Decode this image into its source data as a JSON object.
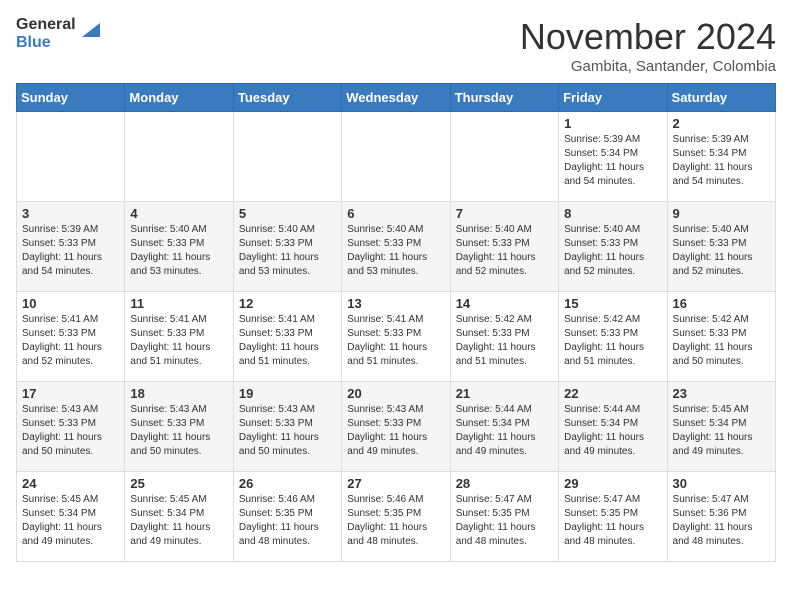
{
  "header": {
    "logo_general": "General",
    "logo_blue": "Blue",
    "month_year": "November 2024",
    "location": "Gambita, Santander, Colombia"
  },
  "weekdays": [
    "Sunday",
    "Monday",
    "Tuesday",
    "Wednesday",
    "Thursday",
    "Friday",
    "Saturday"
  ],
  "weeks": [
    [
      {
        "day": "",
        "sunrise": "",
        "sunset": "",
        "daylight": ""
      },
      {
        "day": "",
        "sunrise": "",
        "sunset": "",
        "daylight": ""
      },
      {
        "day": "",
        "sunrise": "",
        "sunset": "",
        "daylight": ""
      },
      {
        "day": "",
        "sunrise": "",
        "sunset": "",
        "daylight": ""
      },
      {
        "day": "",
        "sunrise": "",
        "sunset": "",
        "daylight": ""
      },
      {
        "day": "1",
        "sunrise": "Sunrise: 5:39 AM",
        "sunset": "Sunset: 5:34 PM",
        "daylight": "Daylight: 11 hours and 54 minutes."
      },
      {
        "day": "2",
        "sunrise": "Sunrise: 5:39 AM",
        "sunset": "Sunset: 5:34 PM",
        "daylight": "Daylight: 11 hours and 54 minutes."
      }
    ],
    [
      {
        "day": "3",
        "sunrise": "Sunrise: 5:39 AM",
        "sunset": "Sunset: 5:33 PM",
        "daylight": "Daylight: 11 hours and 54 minutes."
      },
      {
        "day": "4",
        "sunrise": "Sunrise: 5:40 AM",
        "sunset": "Sunset: 5:33 PM",
        "daylight": "Daylight: 11 hours and 53 minutes."
      },
      {
        "day": "5",
        "sunrise": "Sunrise: 5:40 AM",
        "sunset": "Sunset: 5:33 PM",
        "daylight": "Daylight: 11 hours and 53 minutes."
      },
      {
        "day": "6",
        "sunrise": "Sunrise: 5:40 AM",
        "sunset": "Sunset: 5:33 PM",
        "daylight": "Daylight: 11 hours and 53 minutes."
      },
      {
        "day": "7",
        "sunrise": "Sunrise: 5:40 AM",
        "sunset": "Sunset: 5:33 PM",
        "daylight": "Daylight: 11 hours and 52 minutes."
      },
      {
        "day": "8",
        "sunrise": "Sunrise: 5:40 AM",
        "sunset": "Sunset: 5:33 PM",
        "daylight": "Daylight: 11 hours and 52 minutes."
      },
      {
        "day": "9",
        "sunrise": "Sunrise: 5:40 AM",
        "sunset": "Sunset: 5:33 PM",
        "daylight": "Daylight: 11 hours and 52 minutes."
      }
    ],
    [
      {
        "day": "10",
        "sunrise": "Sunrise: 5:41 AM",
        "sunset": "Sunset: 5:33 PM",
        "daylight": "Daylight: 11 hours and 52 minutes."
      },
      {
        "day": "11",
        "sunrise": "Sunrise: 5:41 AM",
        "sunset": "Sunset: 5:33 PM",
        "daylight": "Daylight: 11 hours and 51 minutes."
      },
      {
        "day": "12",
        "sunrise": "Sunrise: 5:41 AM",
        "sunset": "Sunset: 5:33 PM",
        "daylight": "Daylight: 11 hours and 51 minutes."
      },
      {
        "day": "13",
        "sunrise": "Sunrise: 5:41 AM",
        "sunset": "Sunset: 5:33 PM",
        "daylight": "Daylight: 11 hours and 51 minutes."
      },
      {
        "day": "14",
        "sunrise": "Sunrise: 5:42 AM",
        "sunset": "Sunset: 5:33 PM",
        "daylight": "Daylight: 11 hours and 51 minutes."
      },
      {
        "day": "15",
        "sunrise": "Sunrise: 5:42 AM",
        "sunset": "Sunset: 5:33 PM",
        "daylight": "Daylight: 11 hours and 51 minutes."
      },
      {
        "day": "16",
        "sunrise": "Sunrise: 5:42 AM",
        "sunset": "Sunset: 5:33 PM",
        "daylight": "Daylight: 11 hours and 50 minutes."
      }
    ],
    [
      {
        "day": "17",
        "sunrise": "Sunrise: 5:43 AM",
        "sunset": "Sunset: 5:33 PM",
        "daylight": "Daylight: 11 hours and 50 minutes."
      },
      {
        "day": "18",
        "sunrise": "Sunrise: 5:43 AM",
        "sunset": "Sunset: 5:33 PM",
        "daylight": "Daylight: 11 hours and 50 minutes."
      },
      {
        "day": "19",
        "sunrise": "Sunrise: 5:43 AM",
        "sunset": "Sunset: 5:33 PM",
        "daylight": "Daylight: 11 hours and 50 minutes."
      },
      {
        "day": "20",
        "sunrise": "Sunrise: 5:43 AM",
        "sunset": "Sunset: 5:33 PM",
        "daylight": "Daylight: 11 hours and 49 minutes."
      },
      {
        "day": "21",
        "sunrise": "Sunrise: 5:44 AM",
        "sunset": "Sunset: 5:34 PM",
        "daylight": "Daylight: 11 hours and 49 minutes."
      },
      {
        "day": "22",
        "sunrise": "Sunrise: 5:44 AM",
        "sunset": "Sunset: 5:34 PM",
        "daylight": "Daylight: 11 hours and 49 minutes."
      },
      {
        "day": "23",
        "sunrise": "Sunrise: 5:45 AM",
        "sunset": "Sunset: 5:34 PM",
        "daylight": "Daylight: 11 hours and 49 minutes."
      }
    ],
    [
      {
        "day": "24",
        "sunrise": "Sunrise: 5:45 AM",
        "sunset": "Sunset: 5:34 PM",
        "daylight": "Daylight: 11 hours and 49 minutes."
      },
      {
        "day": "25",
        "sunrise": "Sunrise: 5:45 AM",
        "sunset": "Sunset: 5:34 PM",
        "daylight": "Daylight: 11 hours and 49 minutes."
      },
      {
        "day": "26",
        "sunrise": "Sunrise: 5:46 AM",
        "sunset": "Sunset: 5:35 PM",
        "daylight": "Daylight: 11 hours and 48 minutes."
      },
      {
        "day": "27",
        "sunrise": "Sunrise: 5:46 AM",
        "sunset": "Sunset: 5:35 PM",
        "daylight": "Daylight: 11 hours and 48 minutes."
      },
      {
        "day": "28",
        "sunrise": "Sunrise: 5:47 AM",
        "sunset": "Sunset: 5:35 PM",
        "daylight": "Daylight: 11 hours and 48 minutes."
      },
      {
        "day": "29",
        "sunrise": "Sunrise: 5:47 AM",
        "sunset": "Sunset: 5:35 PM",
        "daylight": "Daylight: 11 hours and 48 minutes."
      },
      {
        "day": "30",
        "sunrise": "Sunrise: 5:47 AM",
        "sunset": "Sunset: 5:36 PM",
        "daylight": "Daylight: 11 hours and 48 minutes."
      }
    ]
  ]
}
